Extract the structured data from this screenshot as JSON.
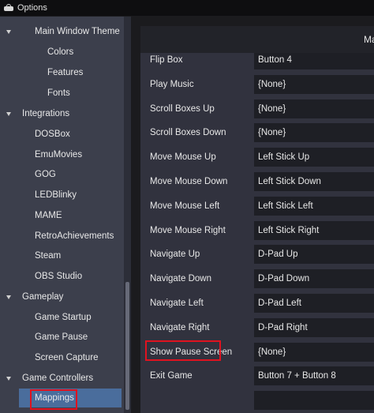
{
  "window": {
    "title": "Options",
    "icon": "gamepad-icon"
  },
  "tree": [
    {
      "label": "Main Window Theme",
      "expanded": true
    },
    {
      "label": "Colors"
    },
    {
      "label": "Features"
    },
    {
      "label": "Fonts"
    },
    {
      "label": "Integrations",
      "expanded": true
    },
    {
      "label": "DOSBox"
    },
    {
      "label": "EmuMovies"
    },
    {
      "label": "GOG"
    },
    {
      "label": "LEDBlinky"
    },
    {
      "label": "MAME"
    },
    {
      "label": "RetroAchievements"
    },
    {
      "label": "Steam"
    },
    {
      "label": "OBS Studio"
    },
    {
      "label": "Gameplay",
      "expanded": true
    },
    {
      "label": "Game Startup"
    },
    {
      "label": "Game Pause"
    },
    {
      "label": "Screen Capture"
    },
    {
      "label": "Game Controllers",
      "expanded": true
    },
    {
      "label": "Mappings",
      "selected": true
    }
  ],
  "panel": {
    "header_text": "Ma"
  },
  "mappings": [
    {
      "action": "Flip Box",
      "value": "Button 4"
    },
    {
      "action": "Play Music",
      "value": "{None}"
    },
    {
      "action": "Scroll Boxes Up",
      "value": "{None}"
    },
    {
      "action": "Scroll Boxes Down",
      "value": "{None}"
    },
    {
      "action": "Move Mouse Up",
      "value": "Left Stick Up"
    },
    {
      "action": "Move Mouse Down",
      "value": "Left Stick Down"
    },
    {
      "action": "Move Mouse Left",
      "value": "Left Stick Left"
    },
    {
      "action": "Move Mouse Right",
      "value": "Left Stick Right"
    },
    {
      "action": "Navigate Up",
      "value": "D-Pad Up"
    },
    {
      "action": "Navigate Down",
      "value": "D-Pad Down"
    },
    {
      "action": "Navigate Left",
      "value": "D-Pad Left"
    },
    {
      "action": "Navigate Right",
      "value": "D-Pad Right"
    },
    {
      "action": "Show Pause Screen",
      "value": "{None}",
      "highlighted": true
    },
    {
      "action": "Exit Game",
      "value": "Button 7 + Button 8"
    },
    {
      "action": "",
      "value": ""
    }
  ],
  "colors": {
    "sidebar_bg": "#3c3f4c",
    "selection": "#4a6d9c",
    "highlight_box": "#e0121f",
    "panel_bg": "#31323e",
    "value_bg": "#1e1f25"
  }
}
